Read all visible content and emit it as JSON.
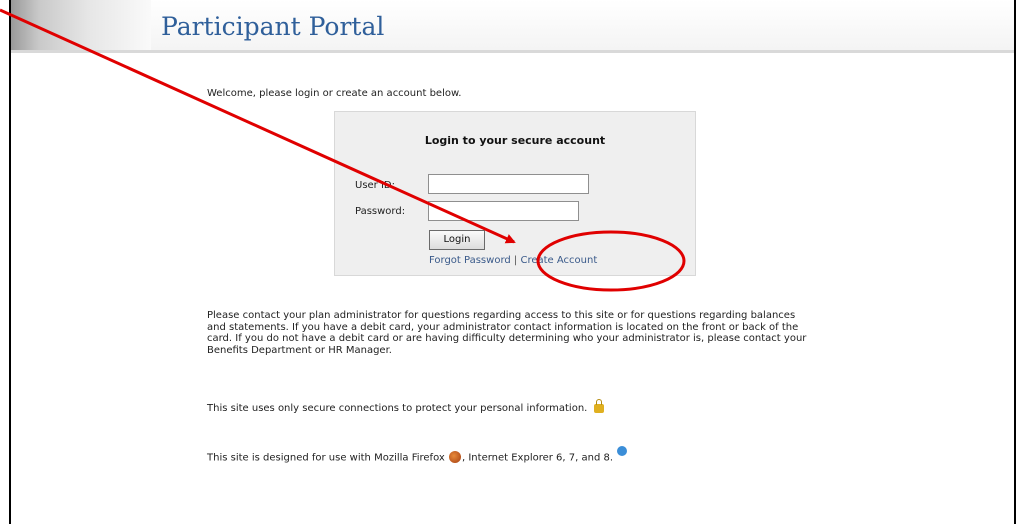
{
  "header": {
    "title": "Participant Portal"
  },
  "welcome_text": "Welcome, please login or create an account below.",
  "login": {
    "title": "Login to your secure account",
    "user_id_label": "User ID:",
    "user_id_value": "",
    "password_label": "Password:",
    "password_value": "",
    "login_button": "Login",
    "forgot_password_link": "Forgot Password",
    "separator": "|",
    "create_account_link": "Create Account"
  },
  "info": {
    "contact_paragraph": "Please contact your plan administrator for questions regarding access to this site or for questions regarding balances and statements. If you have a debit card, your administrator contact information is located on the front or back of the card. If you do not have a debit card or are having difficulty determining who your administrator is, please contact your Benefits Department or HR Manager.",
    "secure_text": "This site uses only secure connections to protect your personal information.",
    "designed_text_1": "This site is designed for use with Mozilla Firefox",
    "designed_text_2": ", Internet Explorer 6, 7, and 8."
  },
  "icons": {
    "lock": "lock-icon",
    "firefox": "firefox-icon",
    "ie": "internet-explorer-icon"
  },
  "annotation": {
    "color": "#e00000"
  }
}
